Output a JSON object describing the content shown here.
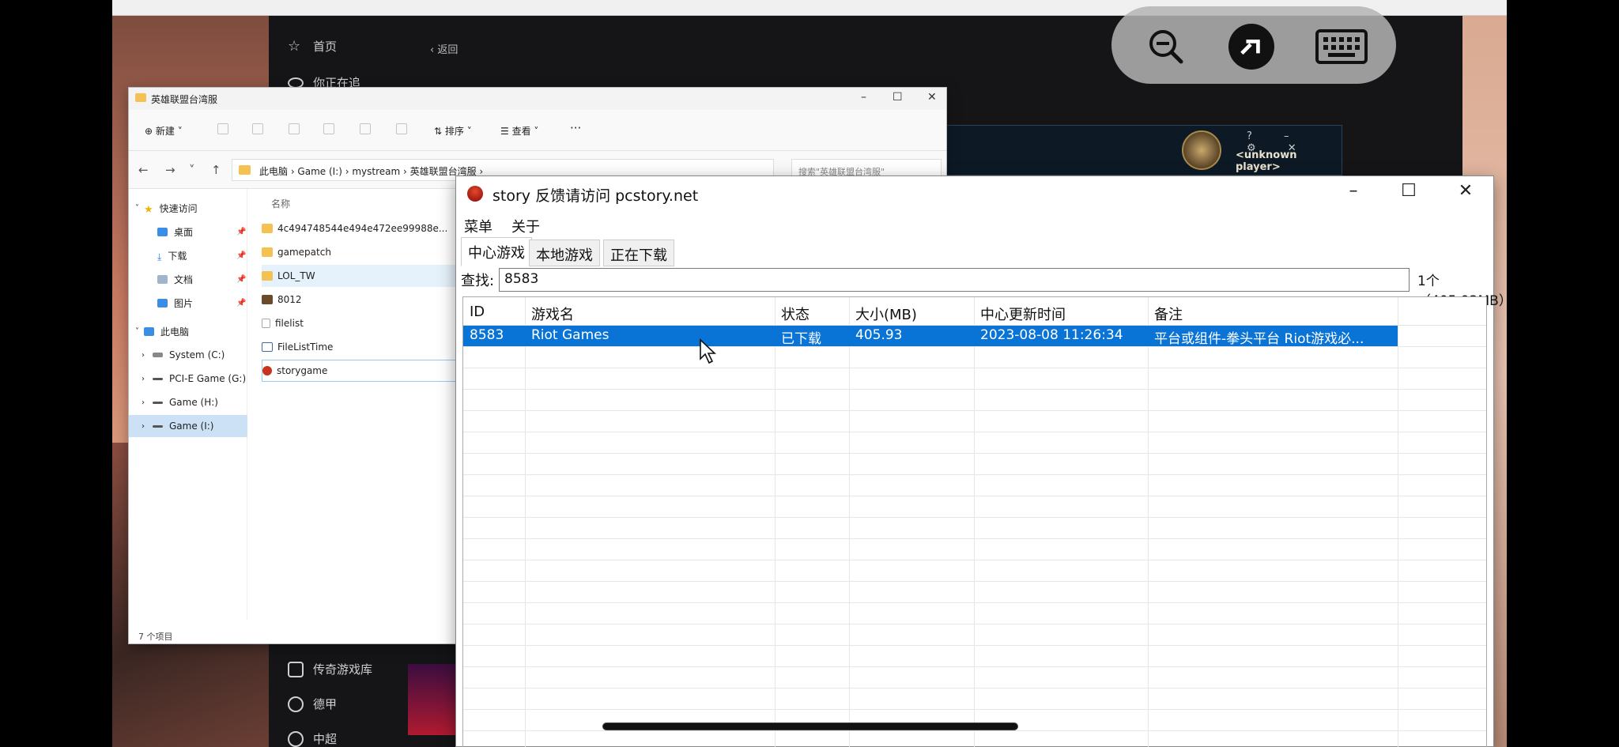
{
  "launcher": {
    "nav_top": [
      "首页",
      "你正在追"
    ],
    "nav_bottom": [
      "传奇游戏库",
      "德甲",
      "中超"
    ],
    "back_label": "‹ 返回"
  },
  "lol_client": {
    "player_name": "<unknown player>",
    "controls": "? – ⚙ ✕"
  },
  "remote_toolbar": {
    "icons": [
      "zoom-out-icon",
      "remote-desktop-icon",
      "keyboard-icon"
    ]
  },
  "explorer": {
    "title": "英雄联盟台湾服",
    "new_label": "新建",
    "sort_label": "排序",
    "view_label": "查看",
    "more_label": "···",
    "address": "此电脑  ›  Game (I:)  ›  mystream  ›  英雄联盟台湾服  ›",
    "search_placeholder": "搜索\"英雄联盟台湾服\"",
    "column_name": "名称",
    "nav": {
      "quick_access": "快速访问",
      "desktop": "桌面",
      "downloads": "下载",
      "documents": "文档",
      "pictures": "图片",
      "this_pc": "此电脑",
      "drive_c": "System (C:)",
      "drive_g": "PCI-E Game (G:)",
      "drive_h": "Game (H:)",
      "drive_i": "Game (I:)"
    },
    "files": [
      "4c494748544e494e472ee99988e...",
      "gamepatch",
      "LOL_TW",
      "8012",
      "filelist",
      "FileListTime",
      "storygame"
    ],
    "status": "7 个项目"
  },
  "story": {
    "title": "story 反馈请访问 pcstory.net",
    "menu": [
      "菜单",
      "关于"
    ],
    "tabs": [
      "中心游戏",
      "本地游戏",
      "正在下载"
    ],
    "find_label": "查找:",
    "find_value": "8583",
    "count": "1个（405.93MB）",
    "columns": [
      "ID",
      "游戏名",
      "状态",
      "大小(MB)",
      "中心更新时间",
      "备注"
    ],
    "rows": [
      {
        "id": "8583",
        "name": "Riot Games",
        "status": "已下载",
        "size": "405.93",
        "updated": "2023-08-08 11:26:34",
        "note": "平台或组件-拳头平台 Riot游戏必..."
      }
    ]
  },
  "colors": {
    "selection": "#0a74d6",
    "folder": "#f4c152"
  }
}
